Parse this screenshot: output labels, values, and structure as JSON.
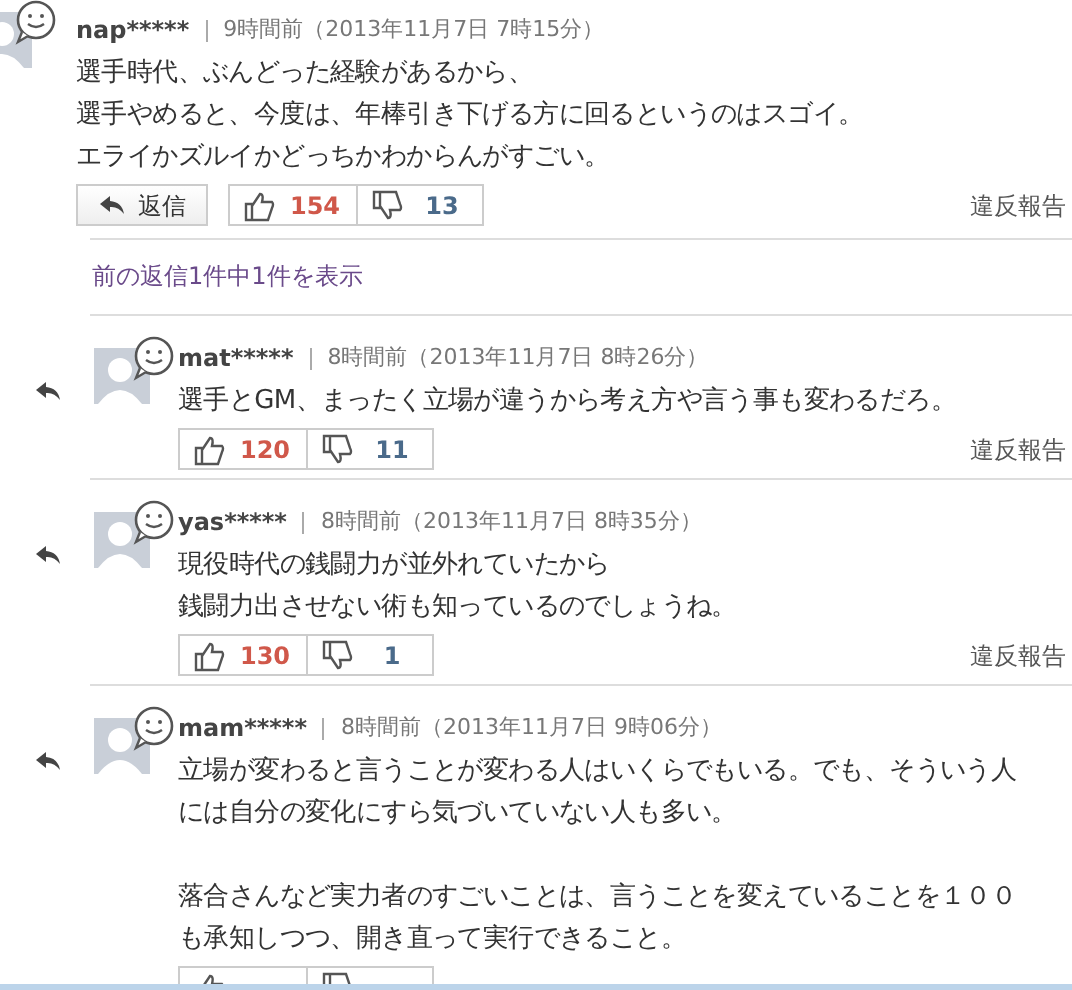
{
  "comment": {
    "user": "nap*****",
    "time": "9時間前（2013年11月7日 7時15分）",
    "paragraphs": [
      [
        "選手時代、ぶんどった経験があるから、",
        "選手やめると、今度は、年棒引き下げる方に回るというのはスゴイ。",
        "エライかズルイかどっちかわからんがすごい。"
      ]
    ],
    "reply_label": "返信",
    "likes": "154",
    "dislikes": "13",
    "report": "違反報告"
  },
  "show_previous": "前の返信1件中1件を表示",
  "replies": [
    {
      "user": "mat*****",
      "time": "8時間前（2013年11月7日 8時26分）",
      "paragraphs": [
        [
          "選手とGM、まったく立場が違うから考え方や言う事も変わるだろ。"
        ]
      ],
      "likes": "120",
      "dislikes": "11",
      "report": "違反報告"
    },
    {
      "user": "yas*****",
      "time": "8時間前（2013年11月7日 8時35分）",
      "paragraphs": [
        [
          "現役時代の銭闘力が並外れていたから",
          "銭闘力出させない術も知っているのでしょうね。"
        ]
      ],
      "likes": "130",
      "dislikes": "1",
      "report": "違反報告"
    },
    {
      "user": "mam*****",
      "time": "8時間前（2013年11月7日 9時06分）",
      "paragraphs": [
        [
          "立場が変わると言うことが変わる人はいくらでもいる。でも、そういう人",
          "には自分の変化にすら気づいていない人も多い。"
        ],
        [
          "落合さんなど実力者のすごいことは、言うことを変えていることを１００",
          "も承知しつつ、開き直って実行できること。"
        ]
      ]
    }
  ]
}
